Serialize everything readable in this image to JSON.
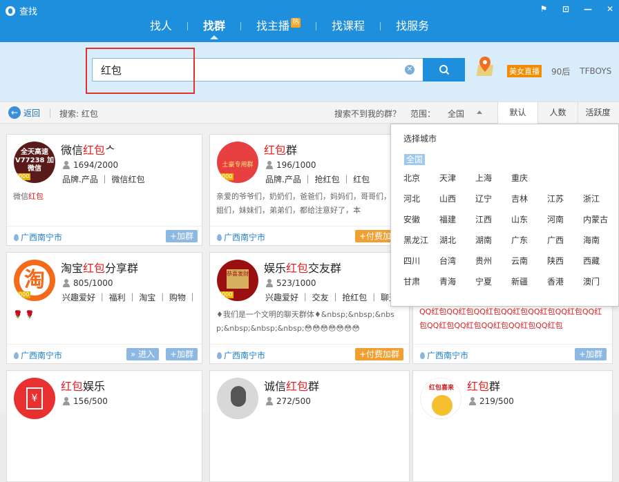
{
  "app": {
    "title": "查找"
  },
  "window_buttons": [
    "⚑",
    "⊡",
    "—",
    "✕"
  ],
  "nav": {
    "tabs": [
      {
        "label": "找人",
        "active": false
      },
      {
        "label": "找群",
        "active": true
      },
      {
        "label": "找主播",
        "active": false,
        "badge": "热"
      },
      {
        "label": "找课程",
        "active": false
      },
      {
        "label": "找服务",
        "active": false
      }
    ]
  },
  "search": {
    "value": "红包",
    "clear_icon": "clear-icon",
    "button_icon": "search-icon"
  },
  "hot": {
    "badge": "美女直播",
    "links": [
      "90后",
      "TFBOYS"
    ]
  },
  "subbar": {
    "back_label": "返回",
    "search_label": "搜索: 红包",
    "not_found": "搜索不到我的群？",
    "range_label": "范围：",
    "range_value": "全国",
    "sort": [
      "默认",
      "人数",
      "活跃度"
    ]
  },
  "cards": [
    {
      "name_pre": "微信",
      "name_red": "红包",
      "name_post": "ᄉ",
      "members": "1694/2000",
      "tags": "品牌.产品 ｜ 微信红包",
      "desc_pre": "微信",
      "desc_red": "红包",
      "desc_post": "",
      "city": "广西南宁市",
      "buttons": [
        "+加群"
      ],
      "avatar_text": "全天高速 V77238 加微信",
      "level": "2000"
    },
    {
      "name_pre": "",
      "name_red": "红包",
      "name_post": "群",
      "members": "196/1000",
      "tags": "品牌.产品 ｜ 抢红包 ｜ 红包",
      "desc_pre": "亲爱的爷爷们，奶奶们，爸爸们，妈妈们，哥哥们，姐姐们，妹妹们，弟弟们，都给注意好了，本",
      "desc_red": "",
      "desc_post": "",
      "city": "广西南宁市",
      "buttons": [
        "+付费加群"
      ],
      "avatar_text": "土豪专用群",
      "level": "1000"
    },
    {
      "name_pre": "淘宝",
      "name_red": "红包",
      "name_post": "分享群",
      "members": "805/1000",
      "tags": "兴趣爱好 ｜ 福利 ｜ 淘宝 ｜ 购物 ｜ 特...",
      "desc_pre": "🌹 🌹",
      "desc_red": "",
      "desc_post": "",
      "city": "广西南宁市",
      "buttons": [
        "» 进入",
        "+加群"
      ],
      "avatar_text": "淘",
      "level": "1000"
    },
    {
      "name_pre": "娱乐",
      "name_red": "红包",
      "name_post": "交友群",
      "members": "523/1000",
      "tags": "兴趣爱好 ｜ 交友 ｜ 抢红包 ｜ 聊天",
      "desc_pre": "♦我们是一个文明的聊天群体♦&nbsp;&nbsp;&nbsp;&nbsp;&nbsp;&nbsp;😳😳😳😳😳😳😳",
      "desc_red": "",
      "desc_post": "",
      "city": "广西南宁市",
      "buttons": [
        "+付费加群"
      ],
      "avatar_text": "恭喜发财",
      "level": "1000"
    },
    {
      "name_pre": "",
      "name_red": "",
      "name_post": "",
      "members": "",
      "tags": "",
      "desc_pre": "QQ红包QQ红包QQ红包QQ红包QQ红包QQ红包QQ红包QQ红包QQ红包QQ红包QQ红包QQ红包",
      "desc_red": "",
      "desc_post": "",
      "city": "广西南宁市",
      "buttons": [
        "+加群"
      ],
      "avatar_text": "",
      "level": ""
    },
    {
      "name_pre": "",
      "name_red": "红包",
      "name_post": "娱乐",
      "members": "156/500",
      "tags": "",
      "desc_pre": "",
      "desc_red": "",
      "desc_post": "",
      "city": "",
      "buttons": [],
      "avatar_text": "¥",
      "level": ""
    },
    {
      "name_pre": "诚信",
      "name_red": "红包",
      "name_post": "群",
      "members": "272/500",
      "tags": "",
      "desc_pre": "",
      "desc_red": "",
      "desc_post": "",
      "city": "",
      "buttons": [],
      "avatar_text": "",
      "level": ""
    },
    {
      "name_pre": "",
      "name_red": "红包",
      "name_post": "群",
      "members": "219/500",
      "tags": "",
      "desc_pre": "",
      "desc_red": "",
      "desc_post": "",
      "city": "",
      "buttons": [],
      "avatar_text": "红包喜来",
      "level": ""
    }
  ],
  "dropdown": {
    "title": "选择城市",
    "all": "全国",
    "cities": [
      "北京",
      "天津",
      "上海",
      "重庆",
      "",
      "",
      "河北",
      "山西",
      "辽宁",
      "吉林",
      "江苏",
      "浙江",
      "安徽",
      "福建",
      "江西",
      "山东",
      "河南",
      "内蒙古",
      "黑龙江",
      "湖北",
      "湖南",
      "广东",
      "广西",
      "海南",
      "四川",
      "台湾",
      "贵州",
      "云南",
      "陕西",
      "西藏",
      "甘肃",
      "青海",
      "宁夏",
      "新疆",
      "香港",
      "澳门"
    ]
  }
}
